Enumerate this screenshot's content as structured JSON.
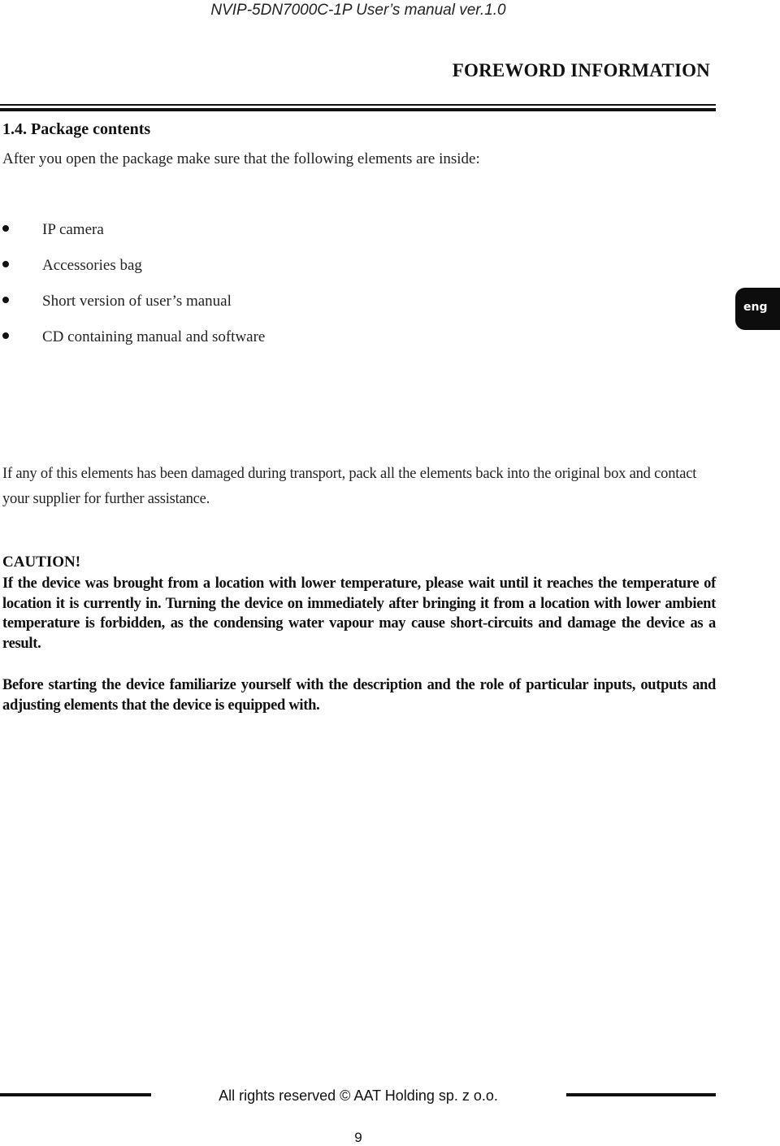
{
  "header": {
    "running_title": "NVIP-5DN7000C-1P User’s manual ver.1.0",
    "chapter_title": "FOREWORD INFORMATION"
  },
  "side_tab": {
    "language": "eng"
  },
  "section": {
    "heading": "1.4. Package contents",
    "intro": "After you open the package make sure that the following elements are inside:",
    "items": [
      {
        "label": "IP camera"
      },
      {
        "label": "Accessories bag"
      },
      {
        "label": "Short version of user’s manual"
      },
      {
        "label": "CD containing manual and software"
      }
    ],
    "damage_note": "If any of this elements has been damaged during transport, pack all the elements back into the original box and contact your supplier for further assistance."
  },
  "caution": {
    "title": "CAUTION!",
    "text": "If the device was brought from a location with lower temperature, please wait until it reaches the temperature of location it is currently in. Turning the device on immediately after bringing it from a location with lower ambient temperature is forbidden, as the condensing water vapour may cause short-circuits and damage the device as a result."
  },
  "before_starting": {
    "text": "Before starting the device familiarize yourself with the description and the role of particular inputs, outputs and adjusting elements that the device is equipped with."
  },
  "footer": {
    "copyright": "All rights reserved © AAT Holding sp. z o.o.",
    "page_number": "9"
  }
}
